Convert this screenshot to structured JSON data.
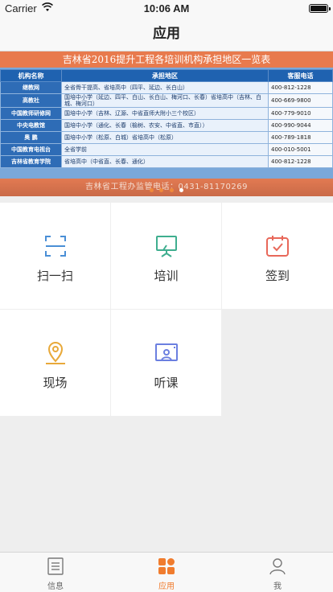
{
  "status_bar": {
    "carrier": "Carrier",
    "time": "10:06 AM"
  },
  "nav": {
    "title": "应用"
  },
  "banner": {
    "title": "吉林省2016提升工程各培训机构承担地区一览表",
    "headers": [
      "机构名称",
      "承担地区",
      "客服电话"
    ],
    "rows": [
      {
        "org": "继教网",
        "area": "全省骨干提高、省培高中（四平、延边、长白山）",
        "phone": "400-812-1228"
      },
      {
        "org": "高教社",
        "area": "国培中小学（延边、四平、白山、长白山、梅河口、长春）省培高中（吉林、白城、梅河口）",
        "phone": "400-669-9800"
      },
      {
        "org": "中国教师研修网",
        "area": "国培中小学（吉林、辽源、中省直师大附小三个校区）",
        "phone": "400-779-9010"
      },
      {
        "org": "中央电教馆",
        "area": "国培中小学（通化、长春（榆树、农安、中省直、市直））",
        "phone": "400-990-9044"
      },
      {
        "org": "奥 鹏",
        "area": "国培中小学（松原、白城）省培高中（松原）",
        "phone": "400-789-1818"
      },
      {
        "org": "中国教育电视台",
        "area": "全省学前",
        "phone": "400-010-5001"
      },
      {
        "org": "吉林省教育学院",
        "area": "省培高中（中省直、长春、通化）",
        "phone": "400-812-1228"
      }
    ],
    "footer": "吉林省工程办监管电话：0431-81170269"
  },
  "apps": [
    {
      "label": "扫一扫",
      "icon": "scan-icon"
    },
    {
      "label": "培训",
      "icon": "training-icon"
    },
    {
      "label": "签到",
      "icon": "checkin-icon"
    },
    {
      "label": "现场",
      "icon": "location-icon"
    },
    {
      "label": "听课",
      "icon": "lecture-icon"
    }
  ],
  "tabs": [
    {
      "label": "信息",
      "icon": "info-icon"
    },
    {
      "label": "应用",
      "icon": "apps-icon",
      "active": true
    },
    {
      "label": "我",
      "icon": "profile-icon"
    }
  ],
  "colors": {
    "accent": "#f07c2e",
    "scan": "#4a8fd6",
    "training": "#3fae8f",
    "checkin": "#e8685a",
    "location": "#e8a93a",
    "lecture": "#6b7fe0"
  }
}
